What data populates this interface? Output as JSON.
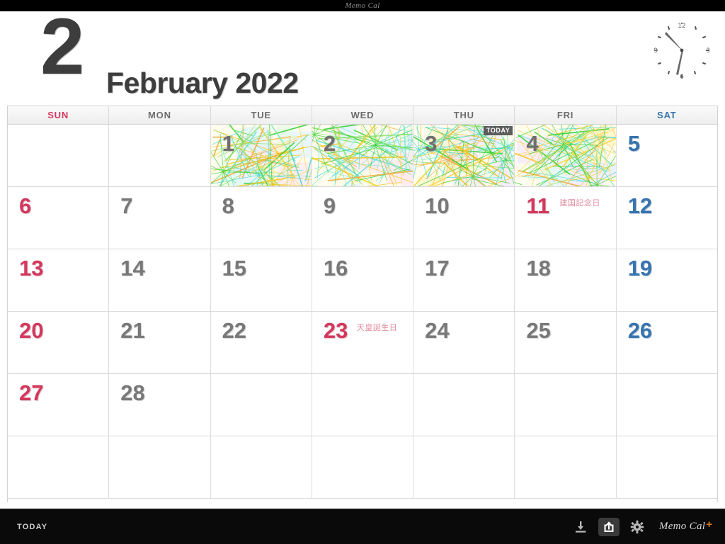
{
  "titlebar": {
    "app_name": "Memo Cal"
  },
  "header": {
    "month_number": "2",
    "month_title": "February 2022",
    "clock": {
      "name": "analog-clock",
      "hour_label_12": "12",
      "hour_label_3": "3",
      "hour_label_6": "6",
      "hour_label_9": "9",
      "time": "10:28"
    }
  },
  "calendar": {
    "weekdays": [
      {
        "label": "SUN",
        "kind": "sun"
      },
      {
        "label": "MON",
        "kind": "weekday"
      },
      {
        "label": "TUE",
        "kind": "weekday"
      },
      {
        "label": "WED",
        "kind": "weekday"
      },
      {
        "label": "THU",
        "kind": "weekday"
      },
      {
        "label": "FRI",
        "kind": "weekday"
      },
      {
        "label": "SAT",
        "kind": "sat"
      }
    ],
    "today_badge_label": "TODAY",
    "weeks": [
      [
        {
          "day": "",
          "kind": "empty"
        },
        {
          "day": "",
          "kind": "empty"
        },
        {
          "day": "1",
          "kind": "weekday",
          "art": true
        },
        {
          "day": "2",
          "kind": "weekday",
          "art": true
        },
        {
          "day": "3",
          "kind": "weekday",
          "art": true,
          "today": true
        },
        {
          "day": "4",
          "kind": "weekday",
          "art": true
        },
        {
          "day": "5",
          "kind": "sat"
        }
      ],
      [
        {
          "day": "6",
          "kind": "sun"
        },
        {
          "day": "7",
          "kind": "weekday"
        },
        {
          "day": "8",
          "kind": "weekday"
        },
        {
          "day": "9",
          "kind": "weekday"
        },
        {
          "day": "10",
          "kind": "weekday"
        },
        {
          "day": "11",
          "kind": "holiday",
          "holiday": "建国記念日"
        },
        {
          "day": "12",
          "kind": "sat"
        }
      ],
      [
        {
          "day": "13",
          "kind": "sun"
        },
        {
          "day": "14",
          "kind": "weekday"
        },
        {
          "day": "15",
          "kind": "weekday"
        },
        {
          "day": "16",
          "kind": "weekday"
        },
        {
          "day": "17",
          "kind": "weekday"
        },
        {
          "day": "18",
          "kind": "weekday"
        },
        {
          "day": "19",
          "kind": "sat"
        }
      ],
      [
        {
          "day": "20",
          "kind": "sun"
        },
        {
          "day": "21",
          "kind": "weekday"
        },
        {
          "day": "22",
          "kind": "weekday"
        },
        {
          "day": "23",
          "kind": "holiday",
          "holiday": "天皇誕生日"
        },
        {
          "day": "24",
          "kind": "weekday"
        },
        {
          "day": "25",
          "kind": "weekday"
        },
        {
          "day": "26",
          "kind": "sat"
        }
      ],
      [
        {
          "day": "27",
          "kind": "sun"
        },
        {
          "day": "28",
          "kind": "weekday"
        },
        {
          "day": "",
          "kind": "empty"
        },
        {
          "day": "",
          "kind": "empty"
        },
        {
          "day": "",
          "kind": "empty"
        },
        {
          "day": "",
          "kind": "empty"
        },
        {
          "day": "",
          "kind": "empty"
        }
      ],
      [
        {
          "day": "",
          "kind": "empty"
        },
        {
          "day": "",
          "kind": "empty"
        },
        {
          "day": "",
          "kind": "empty"
        },
        {
          "day": "",
          "kind": "empty"
        },
        {
          "day": "",
          "kind": "empty"
        },
        {
          "day": "",
          "kind": "empty"
        },
        {
          "day": "",
          "kind": "empty"
        }
      ]
    ]
  },
  "toolbar": {
    "today_label": "TODAY",
    "icons": [
      {
        "name": "import-icon"
      },
      {
        "name": "share-icon"
      },
      {
        "name": "gear-icon"
      }
    ],
    "brand_name": "Memo Cal",
    "brand_plus": "+"
  },
  "colors": {
    "sunday": "#d2395d",
    "saturday": "#3773ae",
    "weekday": "#787878",
    "holiday_label": "#e08a9e",
    "brand_plus": "#d97a22",
    "toolbar_bg": "#0a0a0a",
    "header_bg": "#ffffff"
  }
}
